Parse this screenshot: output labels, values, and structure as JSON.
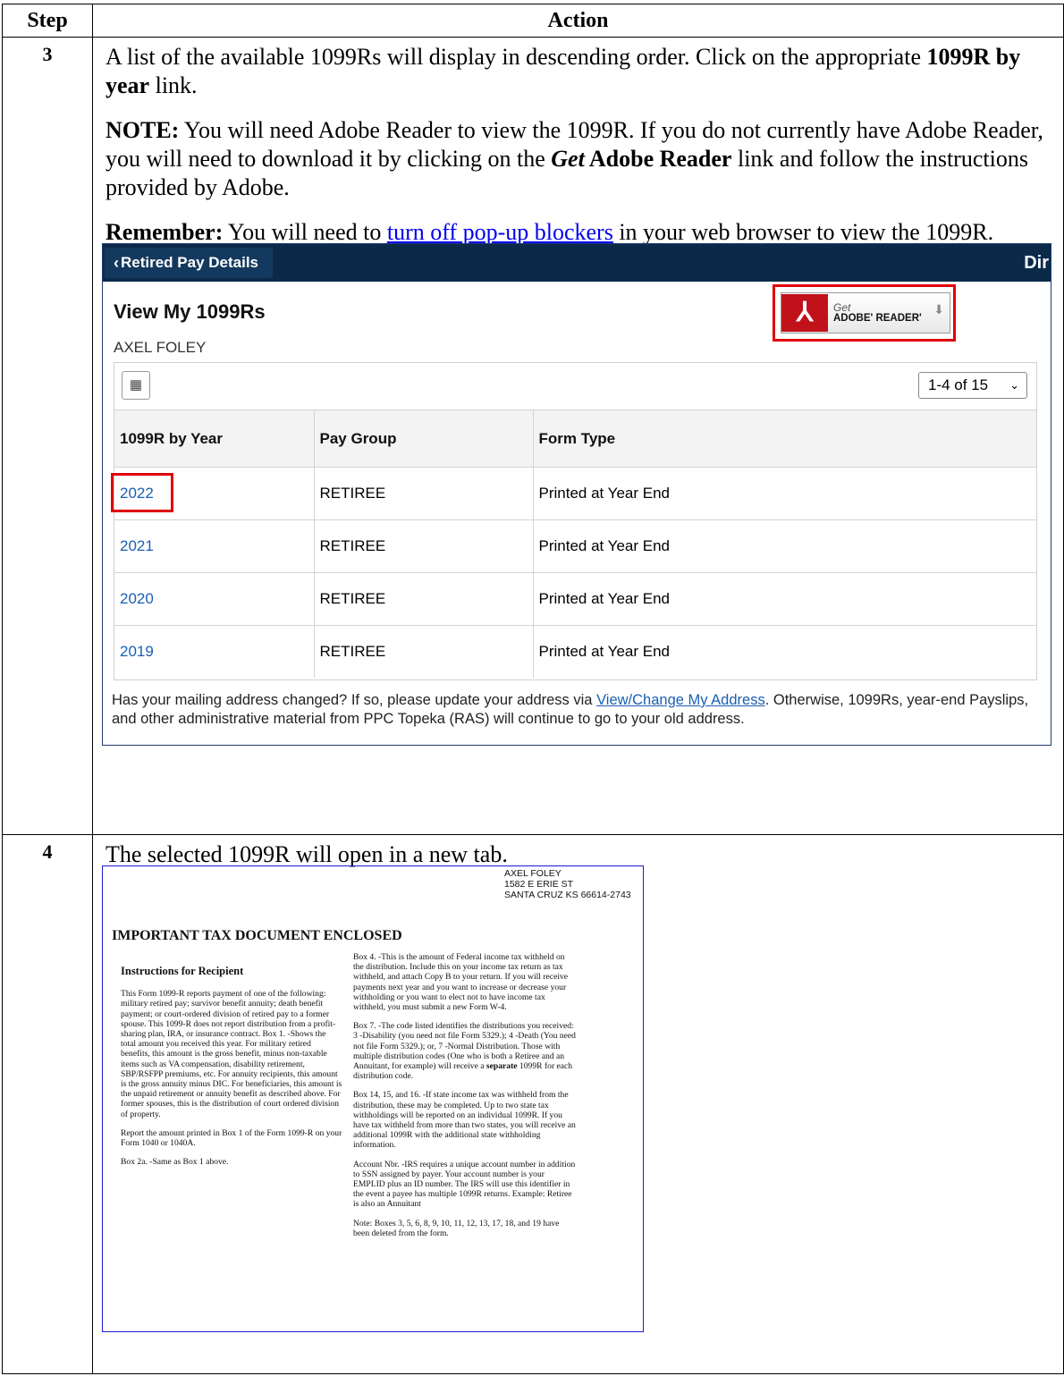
{
  "header": {
    "step": "Step",
    "action": "Action"
  },
  "step3": {
    "num": "3",
    "p1_a": "A list of the available 1099Rs will display in descending order.  Click on the appropriate ",
    "p1_b": "1099R by year",
    "p1_c": " link.",
    "note_label": "NOTE:",
    "note_a": "  You will need Adobe Reader to view the 1099R.  If you do not currently have Adobe Reader, you will need to download it by clicking on the ",
    "note_get": "Get",
    "note_b": " Adobe Reader",
    "note_c": " link and follow the instructions provided by Adobe.",
    "rem_label": "Remember:",
    "rem_a": "  You will need to ",
    "rem_link": "turn off pop-up blockers",
    "rem_b": " in your web browser to view the 1099R."
  },
  "screen": {
    "tab": "Retired Pay Details",
    "right": "Dir",
    "title": "View My 1099Rs",
    "name": "AXEL FOLEY",
    "adobe_get": "Get",
    "adobe_reader": "ADOBE' READER'",
    "pager": "1-4 of 15",
    "columns": [
      "1099R by Year",
      "Pay Group",
      "Form Type"
    ],
    "rows": [
      {
        "year": "2022",
        "group": "RETIREE",
        "type": "Printed at Year End"
      },
      {
        "year": "2021",
        "group": "RETIREE",
        "type": "Printed at Year End"
      },
      {
        "year": "2020",
        "group": "RETIREE",
        "type": "Printed at Year End"
      },
      {
        "year": "2019",
        "group": "RETIREE",
        "type": "Printed at Year End"
      }
    ],
    "notice_a": "Has your mailing address changed? If so, please update your address via ",
    "notice_link": "View/Change My Address",
    "notice_b": ". Otherwise, 1099Rs, year-end Payslips, and other administrative material from PPC Topeka (RAS) will continue to go to your old address."
  },
  "step4": {
    "num": "4",
    "text": "The selected 1099R will open in a new tab.",
    "form": {
      "addr1": "AXEL FOLEY",
      "addr2": "1582 E ERIE ST",
      "addr3": "SANTA CRUZ KS 66614-2743",
      "title": "IMPORTANT TAX DOCUMENT ENCLOSED",
      "instr_title": "Instructions for Recipient",
      "c1p1": "This Form 1099-R reports payment of one of the following: military retired pay; survivor benefit annuity; death benefit payment; or court-ordered division of retired pay to a former spouse. This 1099-R does not report distribution from a profit-sharing plan, IRA, or insurance contract. Box 1. -Shows the total amount you received this year. For military retired benefits, this amount is the gross benefit, minus non-taxable items such as VA compensation, disability retirement, SBP/RSFPP premiums, etc. For annuity recipients, this amount is the gross annuity minus DIC. For beneficiaries, this amount is the unpaid retirement or annuity benefit as described above. For former spouses, this is the distribution of court ordered division of property.",
      "c1p2": "Report the amount printed in Box 1 of the Form 1099-R on your Form 1040 or 1040A.",
      "c1p3": "Box 2a. -Same as Box 1 above.",
      "c2p1": "Box 4. -This is the amount of Federal income tax withheld on the distribution. Include this on your income tax return as tax withheld, and attach Copy B to your return. If you will receive payments next year and you want to increase or decrease your withholding or you want to elect not to have income tax withheld, you must submit a new Form W-4.",
      "c2p2a": "Box 7. -The code listed identifies the distributions you received: 3 -Disability (you need not file Form 5329.); 4 -Death (You need not file Form 5329.); or, 7 -Normal Distribution. Those with multiple distribution codes (One who is both a Retiree and an Annuitant, for example) will receive a ",
      "c2p2b": "separate",
      "c2p2c": " 1099R for each distribution code.",
      "c2p3": "Box 14, 15, and 16. -If state income tax was withheld from the distribution, these may be completed. Up to two state tax withholdings will be reported on an individual 1099R. If you have tax withheld from more than two states, you will receive an additional 1099R with the additional state withholding information.",
      "c2p4": "Account Nbr. -IRS requires a unique account number in addition to SSN assigned by payer.  Your account number is your EMPLID plus an ID number. The IRS will use this identifier in the event a payee has multiple 1099R returns. Example: Retiree is also an Annuitant",
      "c2p5": "Note: Boxes 3, 5, 6, 8, 9, 10, 11, 12, 13, 17, 18, and 19 have been deleted from the form."
    }
  }
}
